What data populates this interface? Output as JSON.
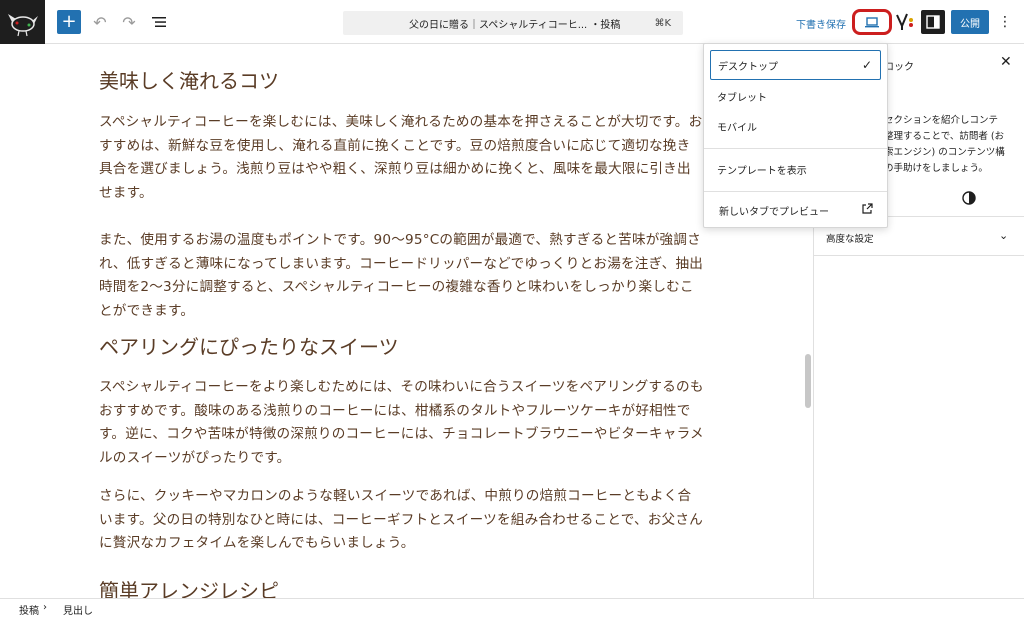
{
  "header": {
    "document_title": "父の日に贈る｜スペシャルティコーヒ... ・投稿",
    "shortcut": "⌘K",
    "save_draft": "下書き保存",
    "publish": "公開"
  },
  "icons": {
    "add": "plus-icon",
    "undo": "undo-icon",
    "redo": "redo-icon",
    "outline": "list-view-icon",
    "device": "desktop-icon",
    "settings": "sidebar-icon",
    "more": "vertical-dots-icon"
  },
  "colors": {
    "accent": "#2271b1",
    "highlight": "#cc1e1e",
    "body_text": "#5a3c26"
  },
  "article": {
    "heading1": "美味しく淹れるコツ",
    "p1": "スペシャルティコーヒーを楽しむには、美味しく淹れるための基本を押さえることが大切です。おすすめは、新鮮な豆を使用し、淹れる直前に挽くことです。豆の焙煎度合いに応じて適切な挽き具合を選びましょう。浅煎り豆はやや粗く、深煎り豆は細かめに挽くと、風味を最大限に引き出せます。",
    "p2": "また、使用するお湯の温度もポイントです。90〜95°Cの範囲が最適で、熱すぎると苦味が強調され、低すぎると薄味になってしまいます。コーヒードリッパーなどでゆっくりとお湯を注ぎ、抽出時間を2〜3分に調整すると、スペシャルティコーヒーの複雑な香りと味わいをしっかり楽しむことができます。",
    "heading2": "ペアリングにぴったりなスイーツ",
    "p3": "スペシャルティコーヒーをより楽しむためには、その味わいに合うスイーツをペアリングするのもおすすめです。酸味のある浅煎りのコーヒーには、柑橘系のタルトやフルーツケーキが好相性です。逆に、コクや苦味が特徴の深煎りのコーヒーには、チョコレートブラウニーやビターキャラメルのスイーツがぴったりです。",
    "p4": "さらに、クッキーやマカロンのような軽いスイーツであれば、中煎りの焙煎コーヒーともよく合います。父の日の特別なひと時には、コーヒーギフトとスイーツを組み合わせることで、お父さんに贅沢なカフェタイムを楽しんでもらいましょう。",
    "heading3": "簡単アレンジレシピ"
  },
  "sidebar": {
    "tab_fragment": "ロック",
    "desc_lines": [
      "セクションを紹介しコンテ",
      "整理することで、訪問者 (お",
      "索エンジン) のコンテンツ構",
      "の手助けをしましょう。"
    ],
    "advanced": "高度な設定"
  },
  "preview_menu": {
    "desktop": "デスクトップ",
    "tablet": "タブレット",
    "mobile": "モバイル",
    "show_template": "テンプレートを表示",
    "new_tab_preview": "新しいタブでプレビュー"
  },
  "footer": {
    "crumb1": "投稿",
    "crumb2": "見出し"
  }
}
